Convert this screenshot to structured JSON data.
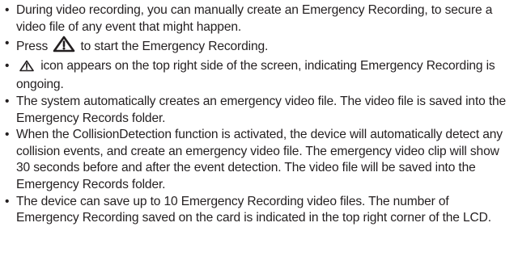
{
  "bullet_char": "•",
  "items": [
    {
      "text": "During video recording, you can manually create an Emergency Recording, to secure a video file of any event that might happen."
    },
    {
      "before": "Press",
      "icon": "warning-triangle-icon",
      "after": "to start the Emergency Recording."
    },
    {
      "icon": "warning-triangle-icon",
      "after": "icon appears on the top right side of the screen, indicating Emergency Recording is ongoing."
    },
    {
      "text": "The system automatically creates an emergency video file. The video file is saved into the Emergency Records folder."
    },
    {
      "text": "When the CollisionDetection function is activated, the device will automatically detect any collision events, and create an emergency video file. The emergency video clip will show 30 seconds before and after the event detection. The video file will be saved into the Emergency Records folder."
    },
    {
      "text": "The device can save up to 10 Emergency Recording video files. The number of Emergency Recording saved on the card is indicated in the top right corner of the LCD."
    }
  ]
}
